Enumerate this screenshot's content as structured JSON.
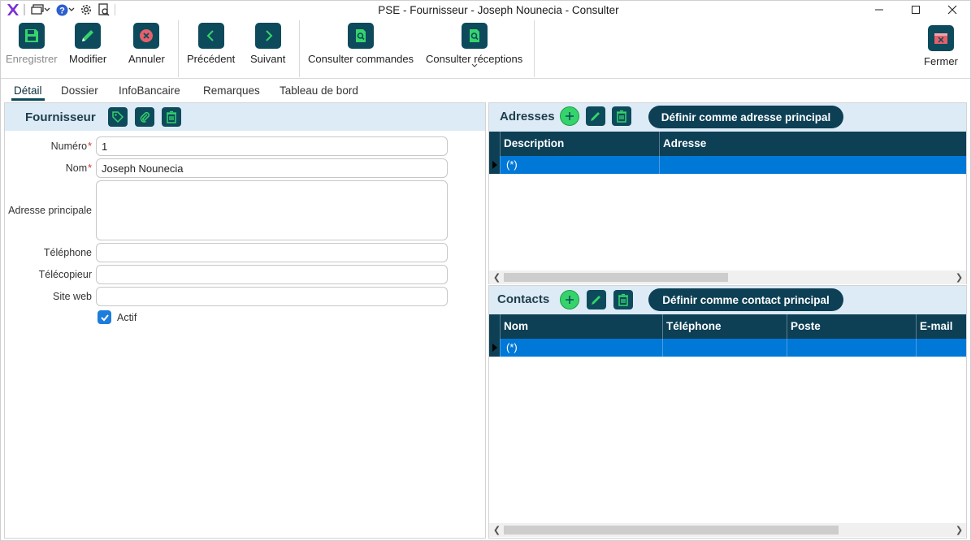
{
  "window": {
    "title": "PSE - Fournisseur - Joseph Nounecia - Consulter"
  },
  "quick_access": [
    "app-logo",
    "windows-menu-icon",
    "help-icon",
    "settings-icon",
    "print-preview-icon"
  ],
  "ribbon": {
    "save": "Enregistrer",
    "edit": "Modifier",
    "cancel": "Annuler",
    "previous": "Précédent",
    "next": "Suivant",
    "orders": "Consulter commandes",
    "receptions": "Consulter réceptions",
    "close": "Fermer"
  },
  "tabs": [
    "Détail",
    "Dossier",
    "InfoBancaire",
    "Remarques",
    "Tableau de bord"
  ],
  "active_tab": "Détail",
  "supplier": {
    "section_title": "Fournisseur",
    "fields": {
      "numero_label": "Numéro",
      "numero_value": "1",
      "nom_label": "Nom",
      "nom_value": "Joseph Nounecia",
      "adresse_label": "Adresse principale",
      "adresse_value": "",
      "telephone_label": "Téléphone",
      "telephone_value": "",
      "telecopieur_label": "Télécopieur",
      "telecopieur_value": "",
      "site_label": "Site web",
      "site_value": ""
    },
    "actif_label": "Actif",
    "actif_checked": true
  },
  "addresses": {
    "title": "Adresses",
    "set_primary_label": "Définir comme adresse principal",
    "columns": [
      "Description",
      "Adresse"
    ],
    "new_row_marker": "(*)"
  },
  "contacts": {
    "title": "Contacts",
    "set_primary_label": "Définir comme contact principal",
    "columns": [
      "Nom",
      "Téléphone",
      "Poste",
      "E-mail"
    ],
    "new_row_marker": "(*)"
  },
  "colors": {
    "accent_dark": "#0d4a5c",
    "grid_header": "#0d3f55",
    "selected_row": "#0078d7",
    "section_header_bg": "#dcebf6",
    "add_green": "#35d46b",
    "logo_purple": "#7a2fd6"
  }
}
